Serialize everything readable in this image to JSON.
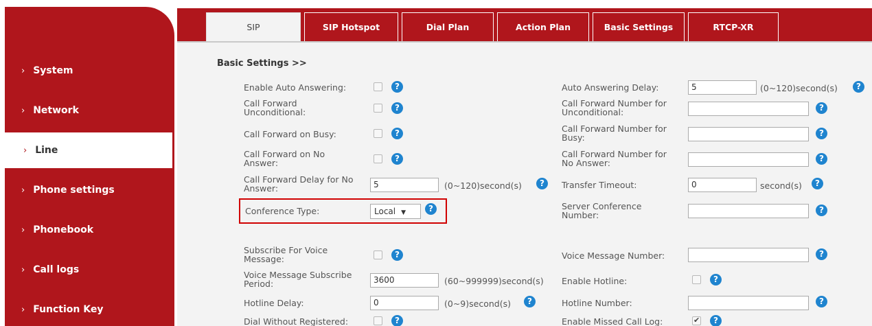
{
  "sidebar": {
    "items": [
      {
        "label": "System"
      },
      {
        "label": "Network"
      },
      {
        "label": "Line"
      },
      {
        "label": "Phone settings"
      },
      {
        "label": "Phonebook"
      },
      {
        "label": "Call logs"
      },
      {
        "label": "Function Key"
      }
    ],
    "active": "Line",
    "chevron": "›"
  },
  "tabs": [
    "SIP",
    "SIP Hotspot",
    "Dial Plan",
    "Action Plan",
    "Basic Settings",
    "RTCP-XR"
  ],
  "active_tab": "SIP",
  "section_title": "Basic Settings >>",
  "help_glyph": "?",
  "form": {
    "enable_auto_answering": {
      "label": "Enable Auto Answering:",
      "checked": false
    },
    "auto_answering_delay": {
      "label": "Auto Answering Delay:",
      "value": "5",
      "unit": "(0~120)second(s)"
    },
    "call_forward_unconditional": {
      "label1": "Call Forward",
      "label2": "Unconditional:",
      "checked": false
    },
    "cf_number_unconditional": {
      "label1": "Call Forward Number for",
      "label2": "Unconditional:",
      "value": ""
    },
    "call_forward_busy": {
      "label": "Call Forward on Busy:",
      "checked": false
    },
    "cf_number_busy": {
      "label1": "Call Forward Number for",
      "label2": "Busy:",
      "value": ""
    },
    "call_forward_no_answer": {
      "label1": "Call Forward on No",
      "label2": "Answer:",
      "checked": false
    },
    "cf_number_no_answer": {
      "label1": "Call Forward Number for",
      "label2": "No Answer:",
      "value": ""
    },
    "cf_delay_no_answer": {
      "label1": "Call Forward Delay for No",
      "label2": "Answer:",
      "value": "5",
      "unit": "(0~120)second(s)"
    },
    "transfer_timeout": {
      "label": "Transfer Timeout:",
      "value": "0",
      "unit": "second(s)"
    },
    "conference_type": {
      "label": "Conference Type:",
      "value": "Local",
      "arrow": "▼"
    },
    "server_conference_number": {
      "label1": "Server Conference",
      "label2": "Number:",
      "value": ""
    },
    "subscribe_voice_message": {
      "label1": "Subscribe For Voice",
      "label2": "Message:",
      "checked": false
    },
    "voice_message_number": {
      "label": "Voice Message Number:",
      "value": ""
    },
    "vm_subscribe_period": {
      "label1": "Voice Message Subscribe",
      "label2": "Period:",
      "value": "3600",
      "unit": "(60~999999)second(s)"
    },
    "enable_hotline": {
      "label": "Enable Hotline:",
      "checked": false
    },
    "hotline_delay": {
      "label": "Hotline Delay:",
      "value": "0",
      "unit": "(0~9)second(s)"
    },
    "hotline_number": {
      "label": "Hotline Number:",
      "value": ""
    },
    "dial_without_registered": {
      "label": "Dial Without Registered:",
      "checked": false
    },
    "enable_missed_call_log": {
      "label": "Enable Missed Call Log:",
      "checked": true
    }
  },
  "colors": {
    "brand_red": "#b0161c",
    "help_blue": "#1f84cf",
    "highlight_red": "#d00000"
  }
}
